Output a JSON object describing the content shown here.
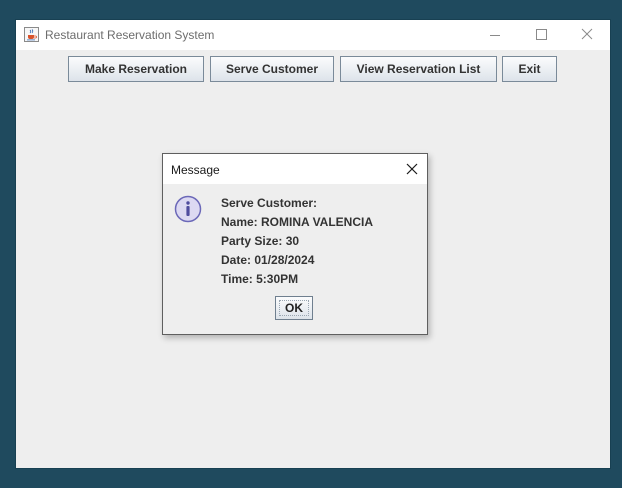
{
  "window": {
    "title": "Restaurant Reservation System",
    "icon": "java-cup-icon"
  },
  "toolbar": {
    "make_reservation_label": "Make Reservation",
    "serve_customer_label": "Serve Customer",
    "view_list_label": "View Reservation List",
    "exit_label": "Exit"
  },
  "dialog": {
    "title": "Message",
    "icon": "info-icon",
    "lines": [
      "Serve Customer:",
      "Name: ROMINA VALENCIA",
      "Party Size: 30",
      "Date: 01/28/2024",
      "Time: 5:30PM"
    ],
    "ok_label": "OK"
  },
  "colors": {
    "desktop": "#1f4a5e",
    "window_bg": "#eeeeee",
    "titlebar": "#ffffff",
    "info_icon_fill": "#dcd9f2",
    "info_icon_stroke": "#6b68b8"
  }
}
